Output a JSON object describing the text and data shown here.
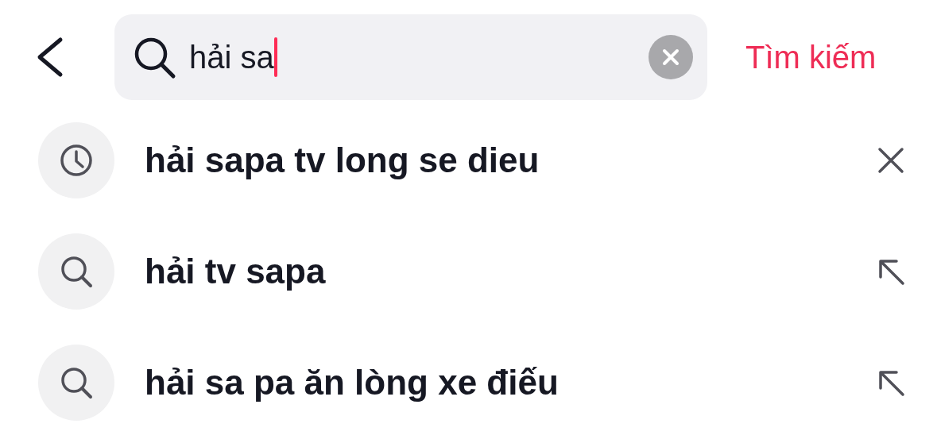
{
  "search": {
    "value": "hải sa",
    "focused": true,
    "submit_label": "Tìm kiếm"
  },
  "suggestions": [
    {
      "kind": "history",
      "text": "hải sapa tv long se dieu"
    },
    {
      "kind": "suggestion",
      "text": "hải tv sapa"
    },
    {
      "kind": "suggestion",
      "text": "hải sa pa ăn lòng xe điếu"
    }
  ]
}
